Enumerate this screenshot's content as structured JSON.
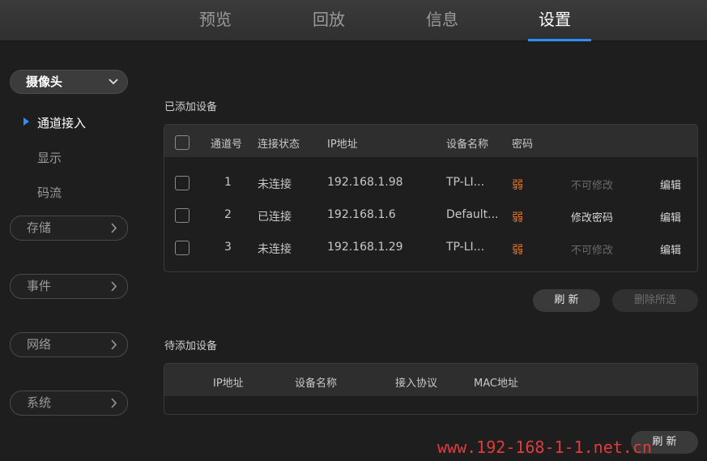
{
  "nav": {
    "tabs": [
      {
        "label": "预览"
      },
      {
        "label": "回放"
      },
      {
        "label": "信息"
      },
      {
        "label": "设置",
        "active": true
      }
    ]
  },
  "sidebar": {
    "dropdown_label": "摄像头",
    "sub_items": [
      {
        "label": "通道接入",
        "active": true
      },
      {
        "label": "显示"
      },
      {
        "label": "码流"
      }
    ],
    "groups": [
      {
        "label": "存储"
      },
      {
        "label": "事件"
      },
      {
        "label": "网络"
      },
      {
        "label": "系统"
      }
    ]
  },
  "added": {
    "title": "已添加设备",
    "headers": [
      "通道号",
      "连接状态",
      "IP地址",
      "设备名称",
      "密码"
    ],
    "rows": [
      {
        "channel": "1",
        "status": "未连接",
        "ip": "192.168.1.98",
        "name": "TP-LI...",
        "password": "弱",
        "change": "不可修改",
        "edit": "编辑",
        "change_enabled": false
      },
      {
        "channel": "2",
        "status": "已连接",
        "ip": "192.168.1.6",
        "name": "Default...",
        "password": "弱",
        "change": "修改密码",
        "edit": "编辑",
        "change_enabled": true
      },
      {
        "channel": "3",
        "status": "未连接",
        "ip": "192.168.1.29",
        "name": "TP-LI...",
        "password": "弱",
        "change": "不可修改",
        "edit": "编辑",
        "change_enabled": false
      }
    ],
    "refresh_label": "刷 新",
    "delete_label": "删除所选"
  },
  "pending": {
    "title": "待添加设备",
    "headers": [
      "IP地址",
      "设备名称",
      "接入协议",
      "MAC地址"
    ],
    "refresh_label": "刷 新"
  },
  "watermark": "www.192-168-1-1.net.cn",
  "colors": {
    "accent": "#2f8fff",
    "weak": "#e8782a",
    "watermark": "#e23b3b"
  }
}
